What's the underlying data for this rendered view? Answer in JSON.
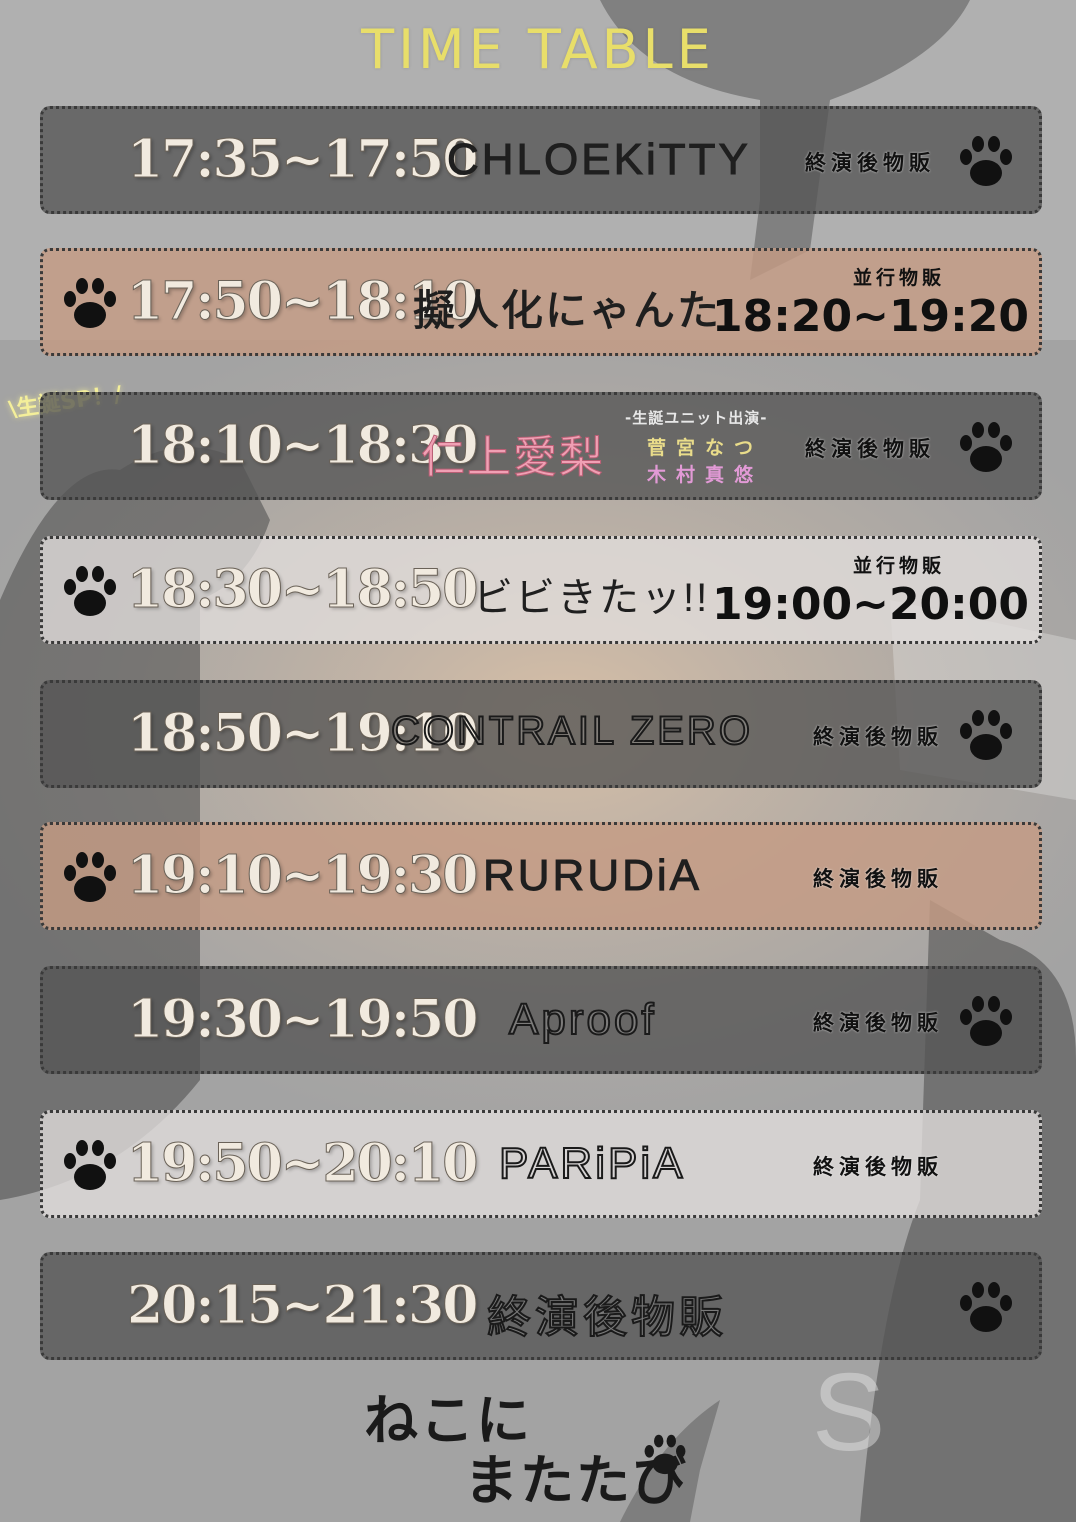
{
  "title": "TIME TABLE",
  "birthday_tag": "\\生誕SP！/",
  "rows": [
    {
      "time": "17:35~17:50",
      "act": "CHLOEKiTTY",
      "merch": "終演後物販",
      "tone": "dark",
      "paw": "right"
    },
    {
      "time": "17:50~18:10",
      "act": "擬人化にゃんた",
      "merch_label": "並行物販",
      "merch_time": "18:20~19:20",
      "tone": "peach",
      "paw": "left"
    },
    {
      "time": "18:10~18:30",
      "act": "仁上愛梨",
      "unit_heading": "-生誕ユニット出演-",
      "unit_member1": "菅宮なつ",
      "unit_member2": "木村真悠",
      "merch": "終演後物販",
      "tone": "dark",
      "paw": "right"
    },
    {
      "time": "18:30~18:50",
      "act": "ビビきたッ!!",
      "merch_label": "並行物販",
      "merch_time": "19:00~20:00",
      "tone": "light",
      "paw": "left"
    },
    {
      "time": "18:50~19:10",
      "act": "CONTRAIL ZERO",
      "merch": "終演後物販",
      "tone": "dark",
      "paw": "right"
    },
    {
      "time": "19:10~19:30",
      "act": "RURUDiA",
      "merch": "終演後物販",
      "tone": "peach",
      "paw": "left"
    },
    {
      "time": "19:30~19:50",
      "act": "Aproof",
      "merch": "終演後物販",
      "tone": "dark",
      "paw": "right"
    },
    {
      "time": "19:50~20:10",
      "act": "PARiPiA",
      "merch": "終演後物販",
      "tone": "light",
      "paw": "left"
    },
    {
      "time": "20:15~21:30",
      "act": "終演後物販",
      "tone": "dark",
      "paw": "right"
    }
  ],
  "logo": {
    "line1": "ねこに",
    "line2": "またたび"
  },
  "colors": {
    "title": "#e8de6a",
    "dark_row": "#555555",
    "peach_row": "#c49b84",
    "light_row": "#e1dedc",
    "aira_pink": "#f0a0b4"
  }
}
